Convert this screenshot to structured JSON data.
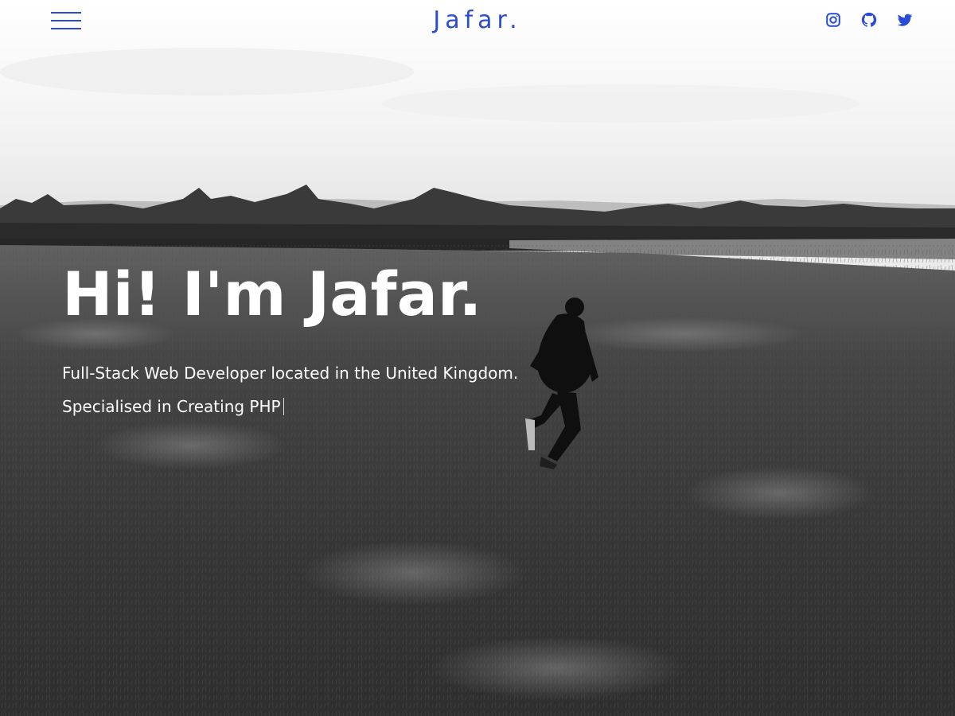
{
  "nav": {
    "brand": "Jafar.",
    "menu_icon": "hamburger-menu-icon",
    "socials": [
      {
        "icon": "instagram-icon",
        "network": "instagram"
      },
      {
        "icon": "github-icon",
        "network": "github"
      },
      {
        "icon": "twitter-icon",
        "network": "twitter"
      }
    ]
  },
  "hero": {
    "title": "Hi! I'm Jafar.",
    "subtitle": "Full-Stack Web Developer located in the United Kingdom.",
    "typed_text": "Specialised in Creating PHP"
  },
  "colors": {
    "accent": "#2a4bd7",
    "hero_text": "#ffffff",
    "sky": "#f4f4f4",
    "field": "#3e3e3e"
  }
}
